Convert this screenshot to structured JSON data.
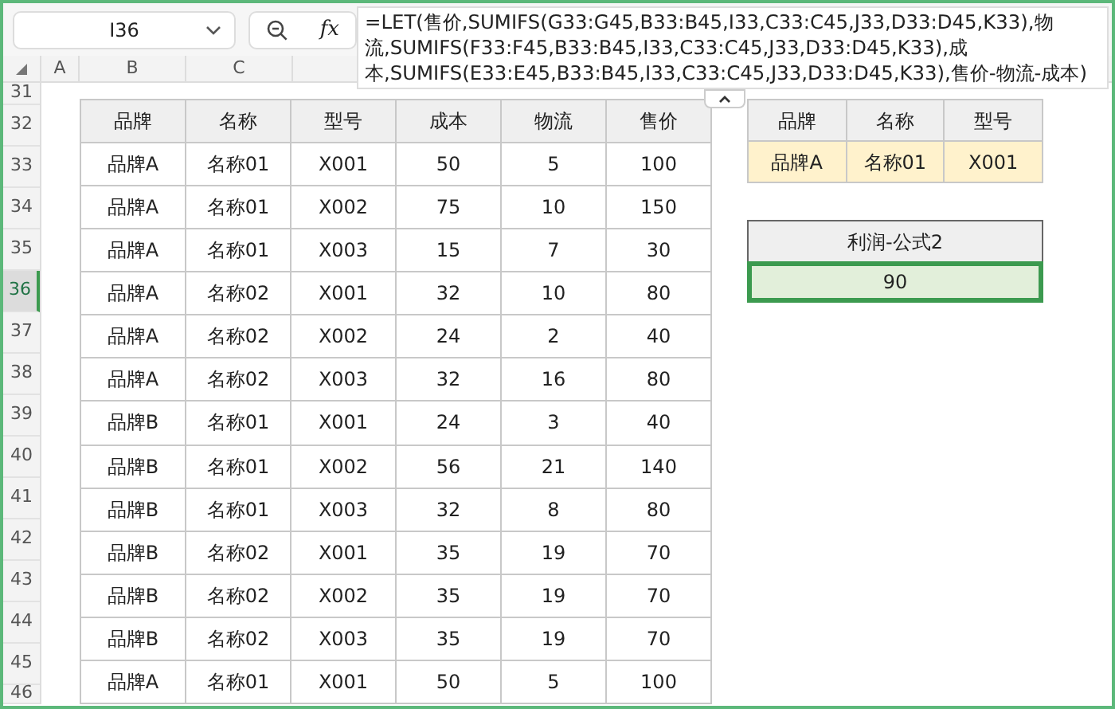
{
  "formula_bar": {
    "name_box": "I36",
    "function_label": "fx",
    "formula_lines": [
      "=LET(售价,SUMIFS(G33:G45,B33:B45,I33,C33:C45,J33,D33:D45,K33),物",
      "流,SUMIFS(F33:F45,B33:B45,I33,C33:C45,J33,D33:D45,K33),成",
      "本,SUMIFS(E33:E45,B33:B45,I33,C33:C45,J33,D33:D45,K33),售价-物流-成本)"
    ]
  },
  "column_headers": [
    "A",
    "B",
    "C"
  ],
  "row_headers": [
    {
      "label": "31",
      "selected": false
    },
    {
      "label": "32",
      "selected": false
    },
    {
      "label": "33",
      "selected": false
    },
    {
      "label": "34",
      "selected": false
    },
    {
      "label": "35",
      "selected": false
    },
    {
      "label": "36",
      "selected": true
    },
    {
      "label": "37",
      "selected": false
    },
    {
      "label": "38",
      "selected": false
    },
    {
      "label": "39",
      "selected": false
    },
    {
      "label": "40",
      "selected": false
    },
    {
      "label": "41",
      "selected": false
    },
    {
      "label": "42",
      "selected": false
    },
    {
      "label": "43",
      "selected": false
    },
    {
      "label": "44",
      "selected": false
    },
    {
      "label": "45",
      "selected": false
    },
    {
      "label": "46",
      "selected": false
    }
  ],
  "data_table": {
    "columns": [
      "品牌",
      "名称",
      "型号",
      "成本",
      "物流",
      "售价"
    ],
    "rows": [
      [
        "品牌A",
        "名称01",
        "X001",
        "50",
        "5",
        "100"
      ],
      [
        "品牌A",
        "名称01",
        "X002",
        "75",
        "10",
        "150"
      ],
      [
        "品牌A",
        "名称01",
        "X003",
        "15",
        "7",
        "30"
      ],
      [
        "品牌A",
        "名称02",
        "X001",
        "32",
        "10",
        "80"
      ],
      [
        "品牌A",
        "名称02",
        "X002",
        "24",
        "2",
        "40"
      ],
      [
        "品牌A",
        "名称02",
        "X003",
        "32",
        "16",
        "80"
      ],
      [
        "品牌B",
        "名称01",
        "X001",
        "24",
        "3",
        "40"
      ],
      [
        "品牌B",
        "名称01",
        "X002",
        "56",
        "21",
        "140"
      ],
      [
        "品牌B",
        "名称01",
        "X003",
        "32",
        "8",
        "80"
      ],
      [
        "品牌B",
        "名称02",
        "X001",
        "35",
        "19",
        "70"
      ],
      [
        "品牌B",
        "名称02",
        "X002",
        "35",
        "19",
        "70"
      ],
      [
        "品牌B",
        "名称02",
        "X003",
        "35",
        "19",
        "70"
      ],
      [
        "品牌A",
        "名称01",
        "X001",
        "50",
        "5",
        "100"
      ]
    ]
  },
  "lookup_table": {
    "columns": [
      "品牌",
      "名称",
      "型号"
    ],
    "values": [
      "品牌A",
      "名称01",
      "X001"
    ]
  },
  "result": {
    "title": "利润-公式2",
    "value": "90",
    "selected": true
  }
}
